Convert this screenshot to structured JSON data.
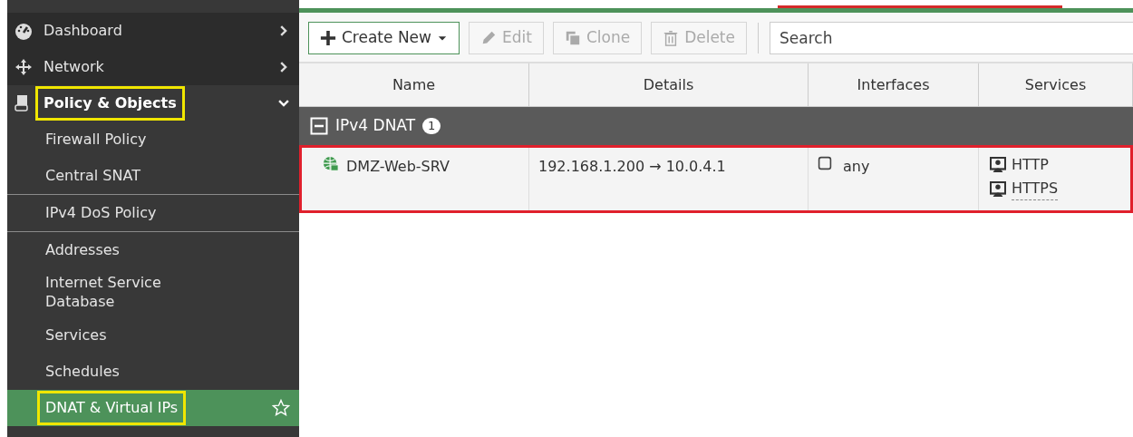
{
  "sidebar": {
    "items": [
      {
        "label": "Dashboard",
        "kind": "section",
        "expanded": false,
        "selected": false,
        "highlighted": false,
        "divider_after": false
      },
      {
        "label": "Network",
        "kind": "section",
        "expanded": false,
        "selected": false,
        "highlighted": false,
        "divider_after": false
      },
      {
        "label": "Policy & Objects",
        "kind": "section",
        "expanded": true,
        "selected": false,
        "highlighted": true,
        "divider_after": false
      },
      {
        "label": "Firewall Policy",
        "kind": "link",
        "selected": false,
        "highlighted": false,
        "divider_after": false
      },
      {
        "label": "Central SNAT",
        "kind": "link",
        "selected": false,
        "highlighted": false,
        "divider_after": true
      },
      {
        "label": "IPv4 DoS Policy",
        "kind": "link",
        "selected": false,
        "highlighted": false,
        "divider_after": true
      },
      {
        "label": "Addresses",
        "kind": "link",
        "selected": false,
        "highlighted": false,
        "divider_after": false
      },
      {
        "label": "Internet Service Database",
        "kind": "link",
        "selected": false,
        "highlighted": false,
        "divider_after": false
      },
      {
        "label": "Services",
        "kind": "link",
        "selected": false,
        "highlighted": false,
        "divider_after": false
      },
      {
        "label": "Schedules",
        "kind": "link",
        "selected": false,
        "highlighted": false,
        "divider_after": false
      },
      {
        "label": "DNAT & Virtual IPs",
        "kind": "link",
        "selected": true,
        "highlighted": true,
        "divider_after": false
      }
    ]
  },
  "toolbar": {
    "buttons": [
      {
        "label": "Create New",
        "primary": true,
        "disabled": false
      },
      {
        "label": "Edit",
        "primary": false,
        "disabled": true
      },
      {
        "label": "Clone",
        "primary": false,
        "disabled": true
      },
      {
        "label": "Delete",
        "primary": false,
        "disabled": true
      }
    ],
    "search": {
      "placeholder": "Search"
    }
  },
  "table": {
    "columns": [
      "Name",
      "Details",
      "Interfaces",
      "Services"
    ],
    "groups": [
      {
        "label": "IPv4 DNAT",
        "count": "1",
        "expanded": true,
        "rows": [
          {
            "name": "DMZ-Web-SRV",
            "details_from": "192.168.1.200",
            "details_arrow": "→",
            "details_to": "10.0.4.1",
            "interfaces": [
              "any"
            ],
            "services": [
              "HTTP",
              "HTTPS"
            ],
            "highlighted": true
          }
        ]
      }
    ]
  }
}
